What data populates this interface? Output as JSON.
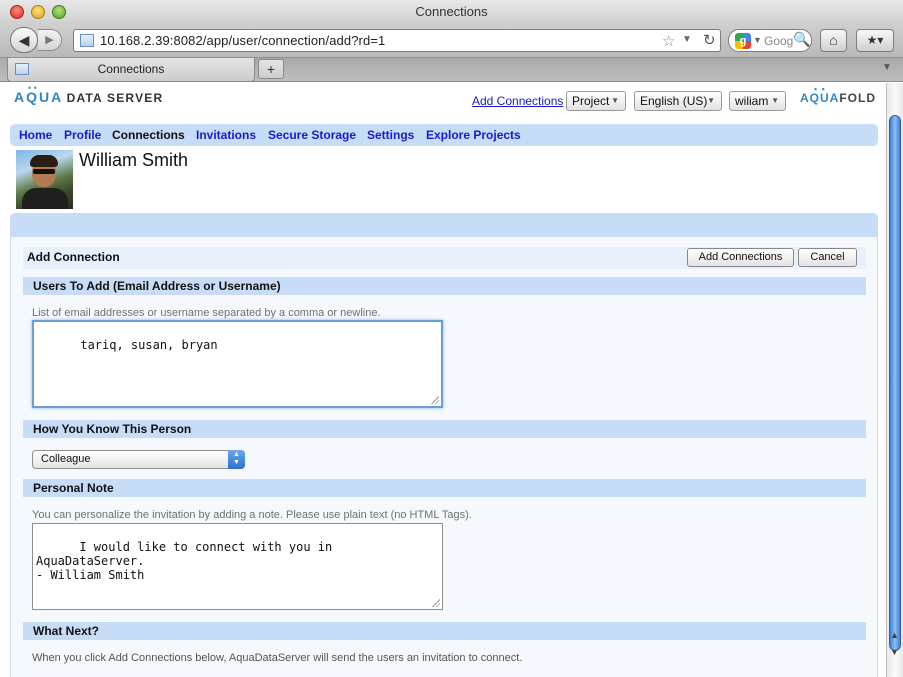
{
  "window": {
    "title": "Connections"
  },
  "toolbar": {
    "back_icon": "◀",
    "forward_icon": "▶",
    "url": "10.168.2.39:8082/app/user/connection/add?rd=1",
    "bookmark_star_icon": "☆",
    "url_dropdown_icon": "▼",
    "reload_icon": "↻",
    "search_engine_glyph": "g",
    "search_dropdown_icon": "▼",
    "search_placeholder": "Goog",
    "search_icon": "🔍",
    "home_icon": "⌂",
    "bookmarks_icon": "★▾"
  },
  "tabs": {
    "active_label": "Connections",
    "new_tab_icon": "+",
    "tab_menu_icon": "▼"
  },
  "header": {
    "logo_left_aqua": "AQUA",
    "logo_left_rest": "DATA SERVER",
    "logo_right_aqua": "AQUA",
    "logo_right_rest": "FOLD",
    "add_connections_link": "Add Connections",
    "project_select": "Project",
    "language_select": "English (US)",
    "user_select": "wiliam",
    "caret_icon": "▼",
    "logo_dots": "• •"
  },
  "nav": {
    "items": [
      "Home",
      "Profile",
      "Connections",
      "Invitations",
      "Secure Storage",
      "Settings",
      "Explore Projects"
    ],
    "active": "Connections"
  },
  "profile": {
    "name": "William Smith"
  },
  "form": {
    "title": "Add Connection",
    "add_button": "Add Connections",
    "cancel_button": "Cancel",
    "users_section": "Users To Add (Email Address or Username)",
    "users_hint": "List of email addresses or username separated by a comma or newline.",
    "users_value": "tariq, susan, bryan",
    "relation_section": "How You Know This Person",
    "relation_value": "Colleague",
    "stepper_up": "▲",
    "stepper_down": "▼",
    "note_section": "Personal Note",
    "note_hint": "You can personalize the invitation by adding a note. Please use plain text (no HTML Tags).",
    "note_value": "I would like to connect with you in AquaDataServer.\n- William Smith",
    "next_section": "What Next?",
    "next_text": "When you click Add Connections below, AquaDataServer will send the users an invitation to connect."
  },
  "scrollbar": {
    "up_icon": "▲",
    "down_icon": "▼"
  }
}
